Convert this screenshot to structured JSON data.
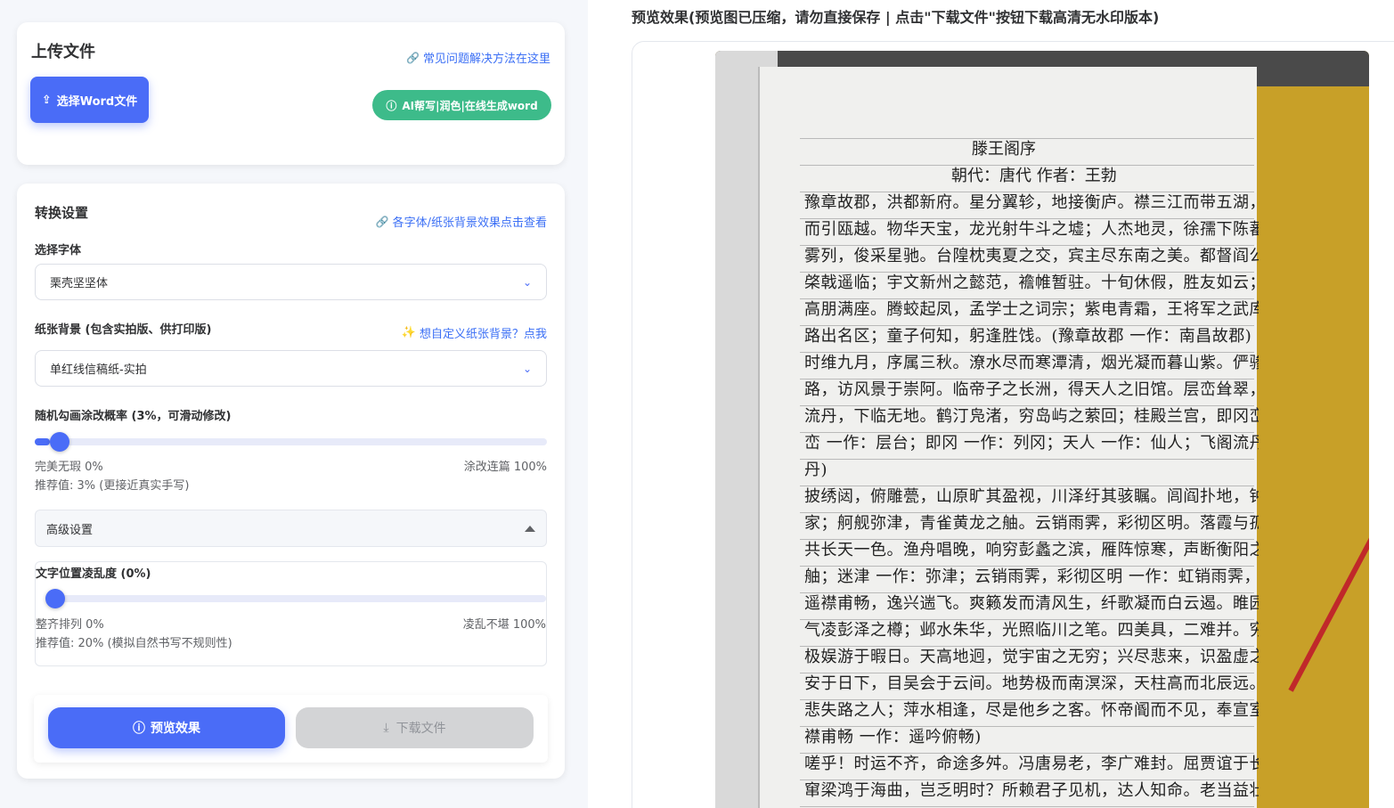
{
  "upload": {
    "title": "上传文件",
    "faq_link": "常见问题解决方法在这里",
    "select_word_button": "选择Word文件",
    "ai_button": "AI帮写|润色|在线生成word"
  },
  "settings": {
    "title": "转换设置",
    "font_effect_link": "各字体/纸张背景效果点击查看",
    "font_label": "选择字体",
    "font_value": "栗壳坚坚体",
    "paper_label": "纸张背景 (包含实拍版、供打印版)",
    "custom_paper_link": "想自定义纸张背景？点我",
    "paper_value": "单红线信稿纸-实拍",
    "scribble_label": "随机勾画涂改概率 (3%，可滑动修改)",
    "scribble_value_percent": 3,
    "scribble_min": "完美无瑕 0%",
    "scribble_max": "涂改连篇 100%",
    "scribble_recommend": "推荐值: 3% (更接近真实手写)",
    "advanced_label": "高级设置",
    "messiness_label": "文字位置凌乱度 (0%)",
    "messiness_value_percent": 0,
    "messiness_min": "整齐排列 0%",
    "messiness_max": "凌乱不堪 100%",
    "messiness_recommend": "推荐值: 20% (模拟自然书写不规则性)",
    "preview_button": "预览效果",
    "download_button": "下载文件"
  },
  "preview": {
    "title": "预览效果(预览图已压缩，请勿直接保存 | 点击\"下载文件\"按钮下载高清无水印版本)",
    "doc_title": "滕王阁序",
    "doc_subtitle": "朝代：唐代 作者：王勃",
    "lines": [
      "豫章故郡，洪都新府。星分翼轸，地接衡庐。襟三江而带五湖，控蛮荆",
      "而引瓯越。物华天宝，龙光射牛斗之墟；人杰地灵，徐孺下陈蕃之榻。雄州",
      "雾列，俊采星驰。台隍枕夷夏之交，宾主尽东南之美。都督阎公之雅望，",
      "棨戟遥临；宇文新州之懿范，襜帷暂驻。十旬休假，胜友如云；千里逢迎，",
      "高朋满座。腾蛟起凤，孟学士之词宗；紫电青霜，王将军之武库。家君作宰，",
      "路出名区；童子何知，躬逢胜饯。(豫章故郡 一作：南昌故郡)",
      "时维九月，序属三秋。潦水尽而寒潭清，烟光凝而暮山紫。俨骖騑于上",
      "路，访风景于崇阿。临帝子之长洲，得天人之旧馆。层峦耸翠，上出重霄；飞阁",
      "流丹，下临无地。鹤汀凫渚，穷岛屿之萦回；桂殿兰宫，即冈峦之体势。(层",
      "峦 一作：层台；即冈 一作：列冈；天人 一作：仙人；飞阁流丹 一作：飞阁翔",
      "丹)",
      "披绣闼，俯雕甍，山原旷其盈视，川泽纡其骇瞩。闾阎扑地，钟鸣鼎食之",
      "家；舸舰弥津，青雀黄龙之舳。云销雨霁，彩彻区明。落霞与孤鹜齐飞，秋水",
      "共长天一色。渔舟唱晚，响穷彭蠡之滨，雁阵惊寒，声断衡阳之浦。(轴 通：",
      "舳；迷津 一作：弥津；云销雨霁，彩彻区明 一作：虹销雨霁，彩彻云衢)",
      "遥襟甫畅，逸兴遄飞。爽籁发而清风生，纤歌凝而白云遏。睢园绿竹，",
      "气凌彭泽之樽；邺水朱华，光照临川之笔。四美具，二难并。穷睇眄于中天，",
      "极娱游于暇日。天高地迥，觉宇宙之无穷；兴尽悲来，识盈虚之有数。望长",
      "安于日下，目吴会于云间。地势极而南溟深，天柱高而北辰远。关山难越，谁",
      "悲失路之人；萍水相逢，尽是他乡之客。怀帝阍而不见，奉宣室以何年？(遥",
      "襟甫畅 一作：遥吟俯畅)",
      "嗟乎！时运不齐，命途多舛。冯唐易老，李广难封。屈贾谊于长沙，非无圣主；",
      "窜梁鸿于海曲，岂乏明时？所赖君子见机，达人知命。老当益壮，宁移白首之心？"
    ]
  }
}
